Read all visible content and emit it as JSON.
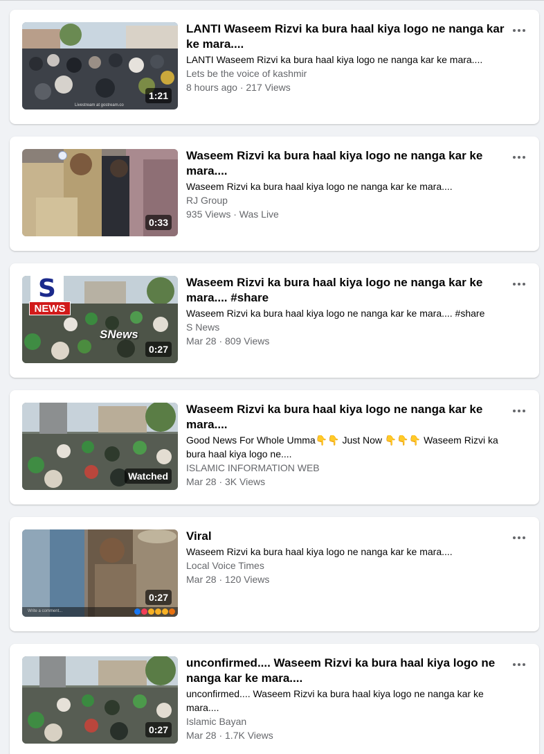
{
  "videos": [
    {
      "title": "LANTI Waseem Rizvi ka bura haal kiya logo ne nanga kar ke mara....",
      "description": "LANTI Waseem Rizvi ka bura haal kiya logo ne nanga kar ke mara....",
      "channel": "Lets be the voice of kashmir",
      "meta": "8 hours ago · 217 Views",
      "duration": "1:21",
      "watermark": "Livestream at gostream.co"
    },
    {
      "title": "Waseem Rizvi ka bura haal kiya logo ne nanga kar ke mara....",
      "description": "Waseem Rizvi ka bura haal kiya logo ne nanga kar ke mara....",
      "channel": "RJ Group",
      "meta": "935 Views · Was Live",
      "duration": "0:33"
    },
    {
      "title": "Waseem Rizvi ka bura haal kiya logo ne nanga kar ke mara.... #share",
      "description": "Waseem Rizvi ka bura haal kiya logo ne nanga kar ke mara.... #share",
      "channel": "S News",
      "meta": "Mar 28 · 809 Views",
      "duration": "0:27",
      "logo_s": "S",
      "logo_news": "NEWS",
      "overlay": "SNews"
    },
    {
      "title": "Waseem Rizvi ka bura haal kiya logo ne nanga kar ke mara....",
      "description": "Good News For Whole Umma👇👇 Just Now 👇👇👇 Waseem Rizvi ka bura haal kiya logo ne....",
      "channel": "ISLAMIC INFORMATION WEB",
      "meta": "Mar 28 · 3K Views",
      "duration": "Watched"
    },
    {
      "title": "Viral",
      "description": "Waseem Rizvi ka bura haal kiya logo ne nanga kar ke mara....",
      "channel": "Local Voice Times",
      "meta": "Mar 28 · 120 Views",
      "duration": "0:27",
      "comment_hint": "Write a comment..."
    },
    {
      "title": "unconfirmed.... Waseem Rizvi ka bura haal kiya logo ne nanga kar ke mara....",
      "description": "unconfirmed.... Waseem Rizvi ka bura haal kiya logo ne nanga kar ke mara....",
      "channel": "Islamic Bayan",
      "meta": "Mar 28 · 1.7K Views",
      "duration": "0:27"
    }
  ],
  "icons": {
    "more": "more-options-icon",
    "play": "video-thumbnail"
  },
  "colors": {
    "background": "#f0f2f5",
    "card": "#ffffff",
    "text_primary": "#050505",
    "text_secondary": "#65676b"
  }
}
